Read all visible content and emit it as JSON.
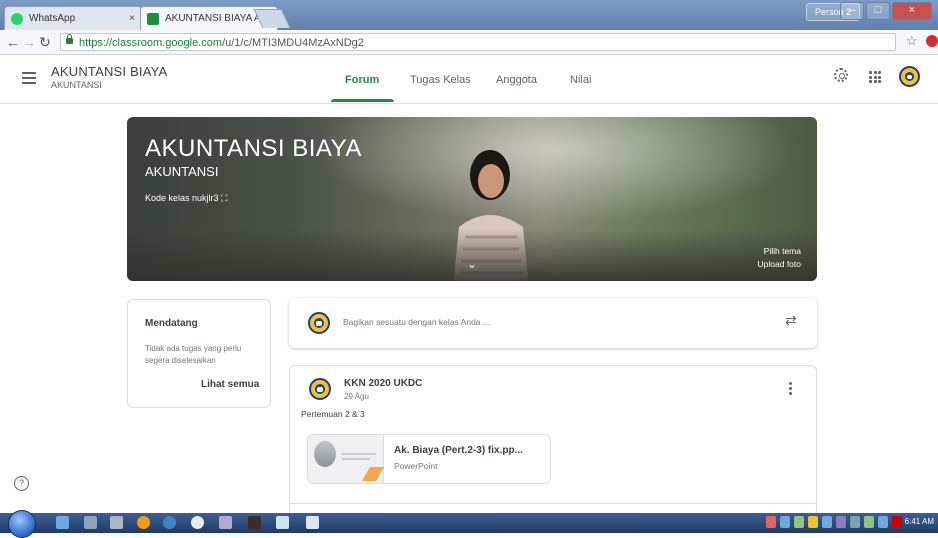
{
  "browser": {
    "tabs": [
      {
        "title": "WhatsApp",
        "icon": "whatsapp-icon",
        "active": false
      },
      {
        "title": "AKUNTANSI BIAYA AKUI",
        "icon": "classroom-icon",
        "active": true
      }
    ],
    "url_host": "https://classroom.google.com",
    "url_path": "/u/1/c/MTI3MDU4MzAxNDg2",
    "profile_label": "Person 2",
    "colors": {
      "accent": "#1e8e3e"
    }
  },
  "header": {
    "class_title": "AKUNTANSI BIAYA",
    "class_subtitle": "AKUNTANSI",
    "tabs": [
      "Forum",
      "Tugas Kelas",
      "Anggota",
      "Nilai"
    ],
    "active_tab": "Forum"
  },
  "banner": {
    "title": "AKUNTANSI BIAYA",
    "subtitle": "AKUNTANSI",
    "class_code_label": "Kode kelas",
    "class_code": "nukjlr3",
    "choose_theme": "Pilih tema",
    "upload_photo": "Upload foto"
  },
  "upcoming": {
    "title": "Mendatang",
    "empty_text": "Tidak ada tugas yang perlu segera diselesaikan",
    "view_all": "Lihat semua"
  },
  "share": {
    "placeholder": "Bagikan sesuatu dengan kelas Anda ..."
  },
  "post": {
    "author": "KKN 2020 UKDC",
    "date": "29 Agu",
    "body": "Pertemuan 2 & 3",
    "attachment": {
      "name": "Ak. Biaya (Pert.2-3) fix.pp...",
      "type": "PowerPoint"
    }
  },
  "taskbar": {
    "clock": "6:41 AM"
  }
}
